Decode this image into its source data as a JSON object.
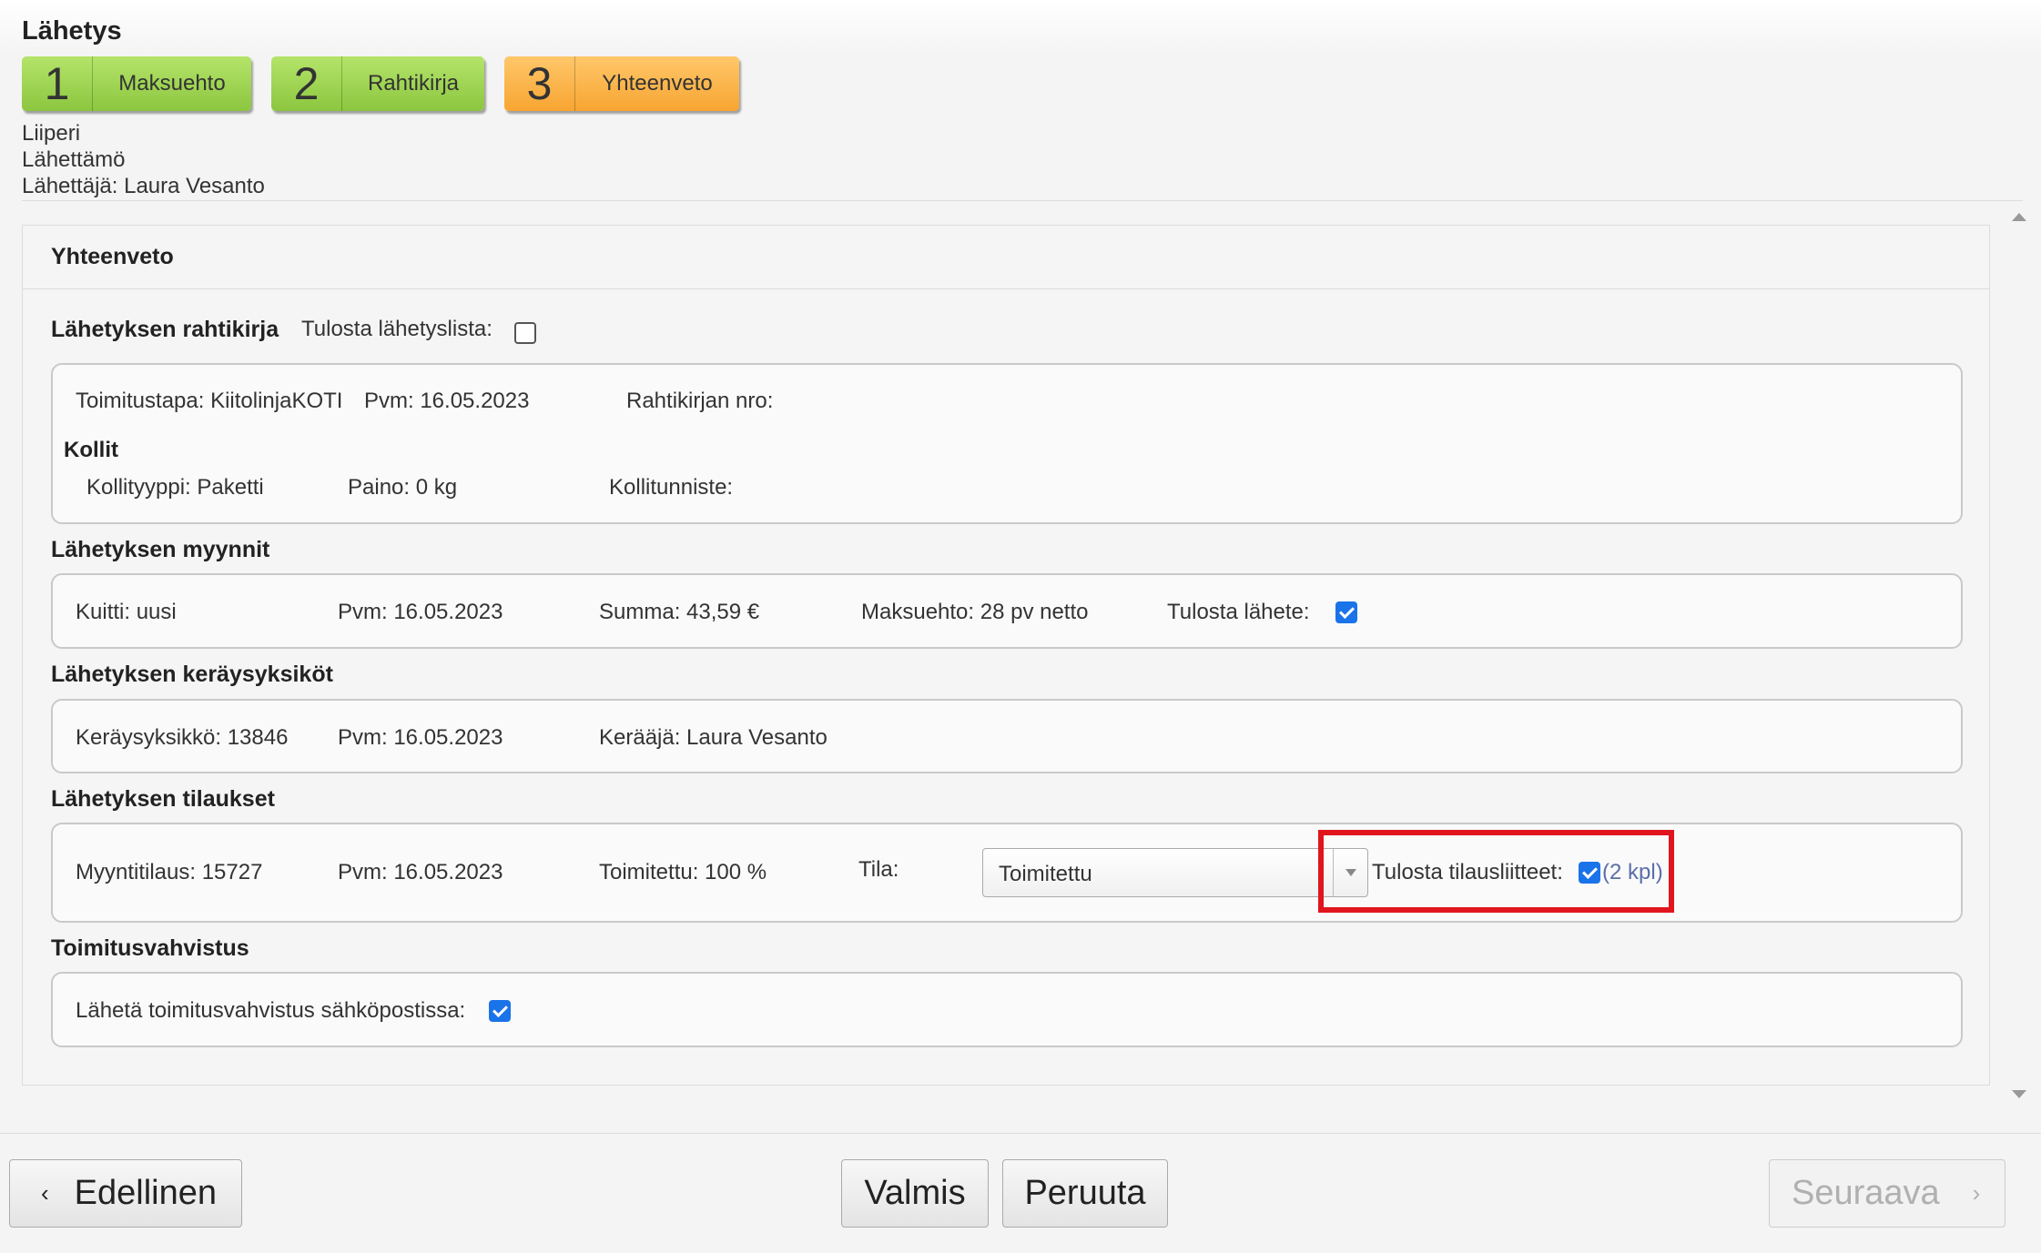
{
  "page": {
    "title": "Lähetys"
  },
  "steps": [
    {
      "num": "1",
      "label": "Maksuehto",
      "state": "done",
      "color": "#8cc63f"
    },
    {
      "num": "2",
      "label": "Rahtikirja",
      "state": "done",
      "color": "#8cc63f"
    },
    {
      "num": "3",
      "label": "Yhteenveto",
      "state": "active",
      "color": "#f7a531"
    }
  ],
  "info": {
    "line1": "Liiperi",
    "line2": "Lähettämö",
    "line3": "Lähettäjä: Laura Vesanto"
  },
  "panel": {
    "title": "Yhteenveto",
    "rahtikirja": {
      "title": "Lähetyksen rahtikirja",
      "print_list_label": "Tulosta lähetyslista:",
      "print_list_checked": false,
      "delivery_method": "Toimitustapa: KiitolinjaKOTI",
      "date": "Pvm: 16.05.2023",
      "waybill_no": "Rahtikirjan nro:",
      "kollit_title": "Kollit",
      "package_type": "Kollityyppi: Paketti",
      "weight": "Paino: 0 kg",
      "package_id": "Kollitunniste:"
    },
    "myynnit": {
      "title": "Lähetyksen myynnit",
      "receipt": "Kuitti: uusi",
      "date": "Pvm: 16.05.2023",
      "sum": "Summa: 43,59 €",
      "payment_term": "Maksuehto: 28 pv netto",
      "print_label": "Tulosta lähete:",
      "print_checked": true
    },
    "keraysyksikot": {
      "title": "Lähetyksen keräysyksiköt",
      "unit": "Keräysyksikkö: 13846",
      "date": "Pvm: 16.05.2023",
      "picker": "Kerääjä: Laura Vesanto"
    },
    "tilaukset": {
      "title": "Lähetyksen tilaukset",
      "order": "Myyntitilaus: 15727",
      "date": "Pvm: 16.05.2023",
      "delivered": "Toimitettu: 100 %",
      "status_label": "Tila:",
      "status_value": "Toimitettu",
      "attachments_label": "Tulosta tilausliitteet:",
      "attachments_checked": true,
      "attachments_count": "(2 kpl)"
    },
    "toimitusvahvistus": {
      "title": "Toimitusvahvistus",
      "email_label": "Lähetä toimitusvahvistus sähköpostissa:",
      "email_checked": true
    }
  },
  "footer": {
    "prev": "Edellinen",
    "done": "Valmis",
    "cancel": "Peruuta",
    "next": "Seuraava"
  },
  "colors": {
    "checkbox": "#1a73e8",
    "highlight": "#e0151e",
    "link": "#1a73e8"
  }
}
